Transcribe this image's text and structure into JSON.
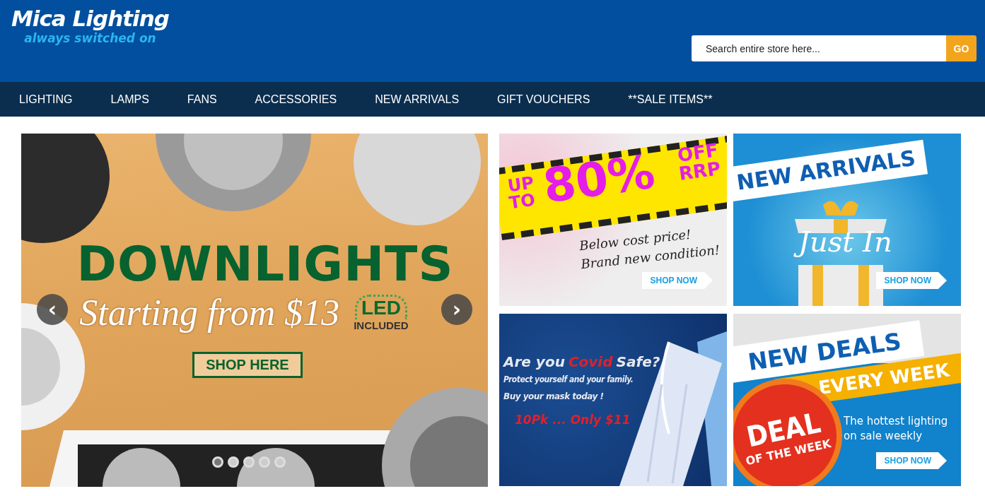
{
  "header": {
    "logo": "Mica Lighting",
    "tagline": "always switched on",
    "search": {
      "placeholder": "Search entire store here...",
      "button": "GO"
    }
  },
  "nav": [
    {
      "label": "LIGHTING"
    },
    {
      "label": "LAMPS"
    },
    {
      "label": "FANS"
    },
    {
      "label": "ACCESSORIES"
    },
    {
      "label": "NEW ARRIVALS"
    },
    {
      "label": "GIFT VOUCHERS"
    },
    {
      "label": "**SALE ITEMS**"
    }
  ],
  "hero": {
    "title": "DOWNLIGHTS",
    "subtitle": "Starting from $13",
    "badge_top": "LED",
    "badge_bottom": "INCLUDED",
    "button": "SHOP HERE",
    "prev": "‹",
    "next": "›",
    "dots": [
      {
        "selected": true
      },
      {
        "selected": false
      },
      {
        "selected": false
      },
      {
        "selected": false
      },
      {
        "selected": false
      }
    ]
  },
  "promos": [
    {
      "kind": "sale",
      "texts": [
        "UP",
        "TO",
        "80%",
        "OFF",
        "RRP",
        "Below cost price!",
        "Brand new condition!"
      ],
      "button": "SHOP NOW"
    },
    {
      "kind": "arrivals",
      "texts": [
        "NEW ARRIVALS",
        "Just In"
      ],
      "button": "SHOP NOW"
    },
    {
      "kind": "covid",
      "texts": [
        "Are you",
        "Covid",
        "Safe?",
        "Protect yourself and your family.",
        "Buy your mask today !",
        "10Pk ... Only $11"
      ]
    },
    {
      "kind": "deals",
      "texts": [
        "NEW DEALS",
        "EVERY WEEK",
        "DEAL",
        "OF THE WEEK",
        "The hottest lighting on sale weekly"
      ],
      "button": "SHOP NOW"
    }
  ]
}
